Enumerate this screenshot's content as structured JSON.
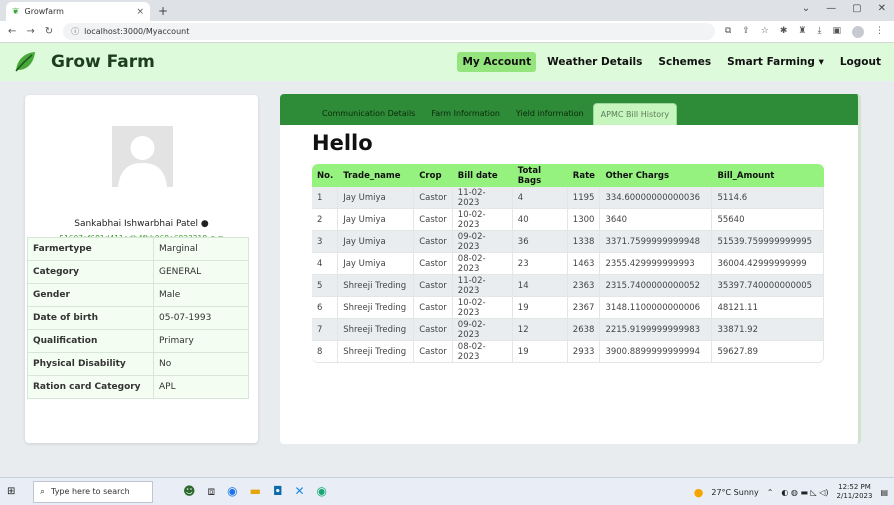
{
  "browser": {
    "tab_title": "Growfarm",
    "tab_close": "×",
    "new_tab": "+",
    "url": "localhost:3000/Myaccount",
    "controls": [
      "⌄",
      "—",
      "▢",
      "✕"
    ]
  },
  "navbar": {
    "brand": "Grow Farm",
    "items": [
      {
        "label": "My Account",
        "active": true
      },
      {
        "label": "Weather Details"
      },
      {
        "label": "Schemes"
      },
      {
        "label": "Smart Farming ▾"
      },
      {
        "label": "Logout"
      }
    ]
  },
  "profile": {
    "name": "Sankabhai Ishwarbhai Patel ●",
    "id": "51607af681d411edb4fbb068e6823218 ●",
    "fields": [
      {
        "key": "Farmertype",
        "value": "Marginal"
      },
      {
        "key": "Category",
        "value": "GENERAL"
      },
      {
        "key": "Gender",
        "value": "Male"
      },
      {
        "key": "Date of birth",
        "value": "05-07-1993"
      },
      {
        "key": "Qualification",
        "value": "Primary"
      },
      {
        "key": "Physical Disability",
        "value": "No"
      },
      {
        "key": "Ration card Category",
        "value": "APL"
      }
    ]
  },
  "bills": {
    "tabs": [
      {
        "label": "Communication Details"
      },
      {
        "label": "Farm Information"
      },
      {
        "label": "Yield information"
      },
      {
        "label": "APMC Bill History",
        "active": true
      }
    ],
    "greeting": "Hello",
    "columns": [
      "No.",
      "Trade_name",
      "Crop",
      "Bill date",
      "Total Bags",
      "Rate",
      "Other Chargs",
      "Bill_Amount"
    ],
    "rows": [
      [
        "1",
        "Jay Umiya",
        "Castor",
        "11-02-2023",
        "4",
        "1195",
        "334.60000000000036",
        "5114.6"
      ],
      [
        "2",
        "Jay Umiya",
        "Castor",
        "10-02-2023",
        "40",
        "1300",
        "3640",
        "55640"
      ],
      [
        "3",
        "Jay Umiya",
        "Castor",
        "09-02-2023",
        "36",
        "1338",
        "3371.7599999999948",
        "51539.759999999995"
      ],
      [
        "4",
        "Jay Umiya",
        "Castor",
        "08-02-2023",
        "23",
        "1463",
        "2355.429999999993",
        "36004.42999999999"
      ],
      [
        "5",
        "Shreeji Treding",
        "Castor",
        "11-02-2023",
        "14",
        "2363",
        "2315.7400000000052",
        "35397.740000000005"
      ],
      [
        "6",
        "Shreeji Treding",
        "Castor",
        "10-02-2023",
        "19",
        "2367",
        "3148.1100000000006",
        "48121.11"
      ],
      [
        "7",
        "Shreeji Treding",
        "Castor",
        "09-02-2023",
        "12",
        "2638",
        "2215.9199999999983",
        "33871.92"
      ],
      [
        "8",
        "Shreeji Treding",
        "Castor",
        "08-02-2023",
        "19",
        "2933",
        "3900.8899999999994",
        "59627.89"
      ]
    ]
  },
  "taskbar": {
    "search_placeholder": "Type here to search",
    "weather": "27°C Sunny",
    "time": "12:52 PM",
    "date": "2/11/2023"
  }
}
